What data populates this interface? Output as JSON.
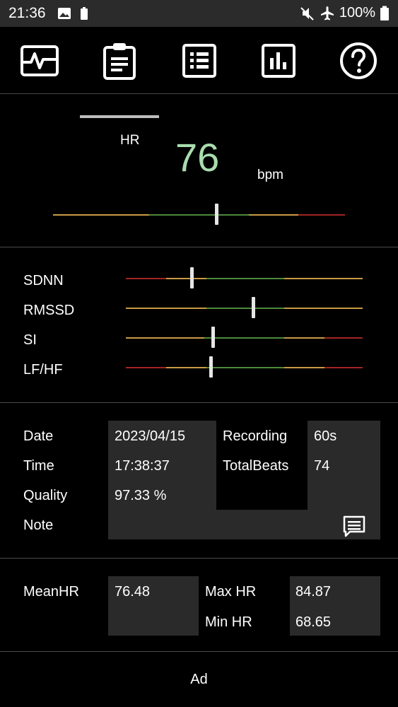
{
  "status": {
    "time": "21:36",
    "battery": "100%",
    "colors": {
      "bar": "#2b2b2b"
    }
  },
  "tabs": [
    {
      "icon": "pulse-icon"
    },
    {
      "icon": "clipboard-icon",
      "active": true
    },
    {
      "icon": "list-icon"
    },
    {
      "icon": "bar-chart-icon"
    },
    {
      "icon": "help-icon"
    }
  ],
  "hr": {
    "label": "HR",
    "value": "76",
    "unit": "bpm",
    "value_color": "#a9dcae",
    "gauge_level": 0.56
  },
  "metrics": [
    {
      "label": "SDNN",
      "level": 0.28
    },
    {
      "label": "RMSSD",
      "level": 0.54
    },
    {
      "label": "SI",
      "level": 0.37
    },
    {
      "label": "LF/HF",
      "level": 0.36
    }
  ],
  "colors": {
    "red": "#a32424",
    "orange": "#c99a45",
    "green": "#4b8a3b"
  },
  "info": {
    "date_label": "Date",
    "date": "2023/04/15",
    "time_label": "Time",
    "time": "17:38:37",
    "quality_label": "Quality",
    "quality": "97.33 %",
    "note_label": "Note",
    "recording_label": "Recording",
    "recording": "60s",
    "totalbeats_label": "TotalBeats",
    "totalbeats": "74"
  },
  "stats": {
    "meanhr_label": "MeanHR",
    "meanhr": "76.48",
    "maxhr_label": "Max HR",
    "maxhr": "84.87",
    "minhr_label": "Min HR",
    "minhr": "68.65"
  },
  "ad": {
    "label": "Ad"
  }
}
